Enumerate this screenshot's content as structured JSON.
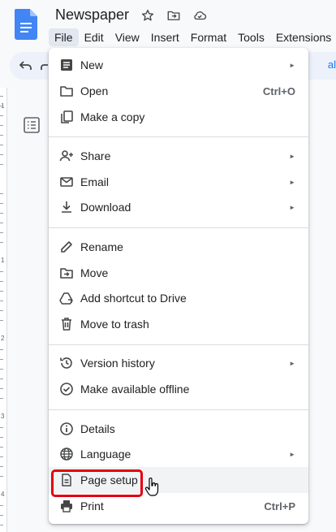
{
  "doc": {
    "title": "Newspaper"
  },
  "menubar": [
    "File",
    "Edit",
    "View",
    "Insert",
    "Format",
    "Tools",
    "Extensions"
  ],
  "toolbar": {
    "fragment": "al"
  },
  "ruler": {
    "numbers": [
      "1",
      "1",
      "2",
      "3",
      "4"
    ]
  },
  "menu": {
    "items": [
      {
        "label": "New",
        "icon": "document-icon",
        "shortcut": "",
        "submenu": true
      },
      {
        "label": "Open",
        "icon": "folder-icon",
        "shortcut": "Ctrl+O",
        "submenu": false
      },
      {
        "label": "Make a copy",
        "icon": "copy-icon",
        "shortcut": "",
        "submenu": false
      },
      {
        "label": "Share",
        "icon": "person-add-icon",
        "shortcut": "",
        "submenu": true
      },
      {
        "label": "Email",
        "icon": "email-icon",
        "shortcut": "",
        "submenu": true
      },
      {
        "label": "Download",
        "icon": "download-icon",
        "shortcut": "",
        "submenu": true
      },
      {
        "label": "Rename",
        "icon": "pencil-icon",
        "shortcut": "",
        "submenu": false
      },
      {
        "label": "Move",
        "icon": "move-folder-icon",
        "shortcut": "",
        "submenu": false
      },
      {
        "label": "Add shortcut to Drive",
        "icon": "drive-shortcut-icon",
        "shortcut": "",
        "submenu": false
      },
      {
        "label": "Move to trash",
        "icon": "trash-icon",
        "shortcut": "",
        "submenu": false
      },
      {
        "label": "Version history",
        "icon": "history-icon",
        "shortcut": "",
        "submenu": true
      },
      {
        "label": "Make available offline",
        "icon": "offline-check-icon",
        "shortcut": "",
        "submenu": false
      },
      {
        "label": "Details",
        "icon": "info-icon",
        "shortcut": "",
        "submenu": false
      },
      {
        "label": "Language",
        "icon": "globe-icon",
        "shortcut": "",
        "submenu": true
      },
      {
        "label": "Page setup",
        "icon": "page-icon",
        "shortcut": "",
        "submenu": false
      },
      {
        "label": "Print",
        "icon": "printer-icon",
        "shortcut": "Ctrl+P",
        "submenu": false
      }
    ],
    "arrow": "►"
  },
  "colors": {
    "highlight": "#e3000f",
    "docs_blue": "#4285f4",
    "accent": "#1a73e8"
  }
}
